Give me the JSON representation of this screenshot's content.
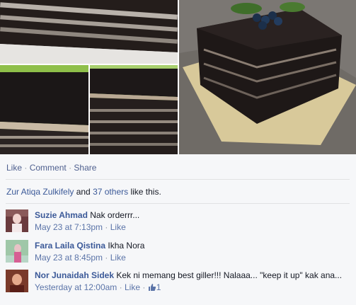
{
  "actions": {
    "like": "Like",
    "comment": "Comment",
    "share": "Share",
    "separator": "·"
  },
  "likes_summary": {
    "name": "Zur Atiqa Zulkifely",
    "and": " and ",
    "others": "37 others",
    "suffix": " like this."
  },
  "comments": [
    {
      "author": "Suzie Ahmad",
      "text": "Nak orderrr...",
      "time": "May 23 at 7:13pm",
      "like": "Like"
    },
    {
      "author": "Fara Laila Qistina",
      "text": "Ikha Nora",
      "time": "May 23 at 8:45pm",
      "like": "Like"
    },
    {
      "author": "Nor Junaidah Sidek",
      "text": "Kek ni memang best giller!!! Nalaaa... \"keep it up\" kak ana...",
      "time": "Yesterday at 12:00am",
      "like": "Like",
      "like_count": "1"
    }
  ],
  "meta_separator": "·",
  "colors": {
    "link": "#3b5998",
    "meta": "#9197a3",
    "feed_bg": "#f6f7f9"
  },
  "icons": [
    "thumbs-up-icon"
  ]
}
